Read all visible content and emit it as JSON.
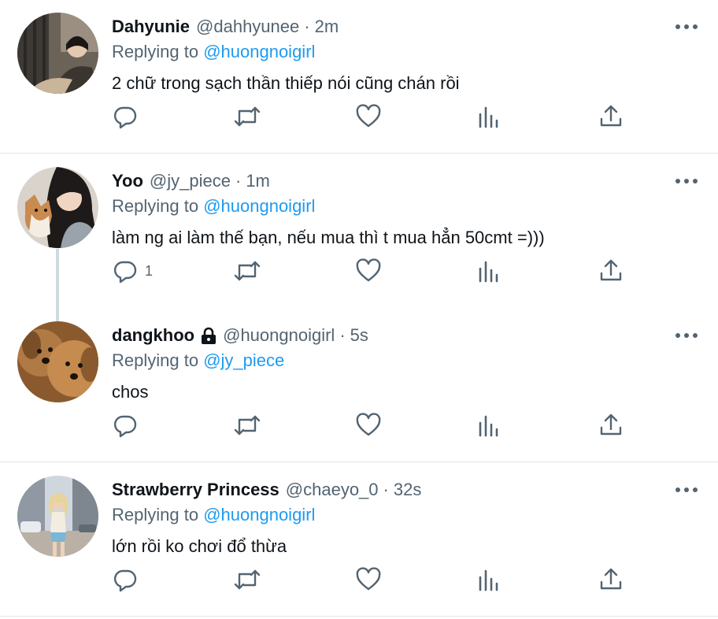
{
  "tweets": [
    {
      "name": "Dahyunie",
      "handle": "@dahhyunee",
      "separator": "·",
      "time": "2m",
      "replying_prefix": "Replying to",
      "replying_to": "@huongnoigirl",
      "text": "2 chữ trong sạch thần thiếp nói cũng chán rồi",
      "reply_count": ""
    },
    {
      "name": "Yoo",
      "handle": "@jy_piece",
      "separator": "·",
      "time": "1m",
      "replying_prefix": "Replying to",
      "replying_to": "@huongnoigirl",
      "text": "làm ng ai làm thế bạn, nếu mua thì t mua hẳn 50cmt =)))",
      "reply_count": "1"
    },
    {
      "name": "dangkhoo",
      "handle": "@huongnoigirl",
      "separator": "·",
      "time": "5s",
      "replying_prefix": "Replying to",
      "replying_to": "@jy_piece",
      "text": "chos",
      "reply_count": ""
    },
    {
      "name": "Strawberry Princess",
      "handle": "@chaeyo_0",
      "separator": "·",
      "time": "32s",
      "replying_prefix": "Replying to",
      "replying_to": "@huongnoigirl",
      "text": "lớn rồi ko chơi đổ thừa",
      "reply_count": ""
    }
  ],
  "icons": {
    "reply": "reply-icon",
    "retweet": "retweet-icon",
    "like": "like-icon",
    "views": "views-icon",
    "share": "share-icon",
    "more": "more-icon",
    "lock": "lock-icon"
  },
  "colors": {
    "text": "#0f1419",
    "secondary": "#536471",
    "link": "#1d9bf0",
    "divider": "#e1e6ea",
    "thread_line": "#cfd9de"
  }
}
